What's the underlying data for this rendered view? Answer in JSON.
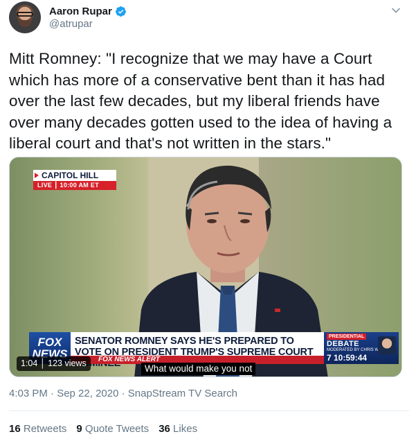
{
  "author": {
    "display_name": "Aaron Rupar",
    "handle": "@atrupar",
    "verified": true,
    "verified_icon": "verified-badge-icon",
    "verified_color": "#1da1f2"
  },
  "tweet": {
    "text": "Mitt Romney: \"I recognize that we may have a Court which has more of a conservative bent than it has had over the last few decades, but my liberal friends have over many decades gotten used to the idea of having a liberal court and that's not written in the stars.\"",
    "timestamp": "4:03 PM · Sep 22, 2020 · SnapStream TV Search"
  },
  "media": {
    "location_title": "CAPITOL HILL",
    "location_live": "LIVE ┃ 10:00 AM ET",
    "network_logo": "FOX NEWS",
    "headline": "SENATOR ROMNEY SAYS HE'S PREPARED TO VOTE ON PRESIDENT TRUMP'S SUPREME COURT NOMINEE",
    "alert_strip": "FOX NEWS ALERT",
    "debate_tag": "PRESIDENTIAL",
    "debate_title": "DEBATE",
    "debate_moderator": "MODERATED BY CHRIS WALLACE",
    "debate_countdown": "7  10:59:44",
    "caption": "What would make you not",
    "video_duration": "1:04",
    "view_count": "123 views"
  },
  "stats": {
    "retweets_count": "16",
    "retweets_label": "Retweets",
    "quotes_count": "9",
    "quotes_label": "Quote Tweets",
    "likes_count": "36",
    "likes_label": "Likes"
  },
  "colors": {
    "text_primary": "#14171a",
    "text_secondary": "#657786",
    "fox_red": "#d6202a",
    "fox_blue": "#1b3f8c"
  }
}
